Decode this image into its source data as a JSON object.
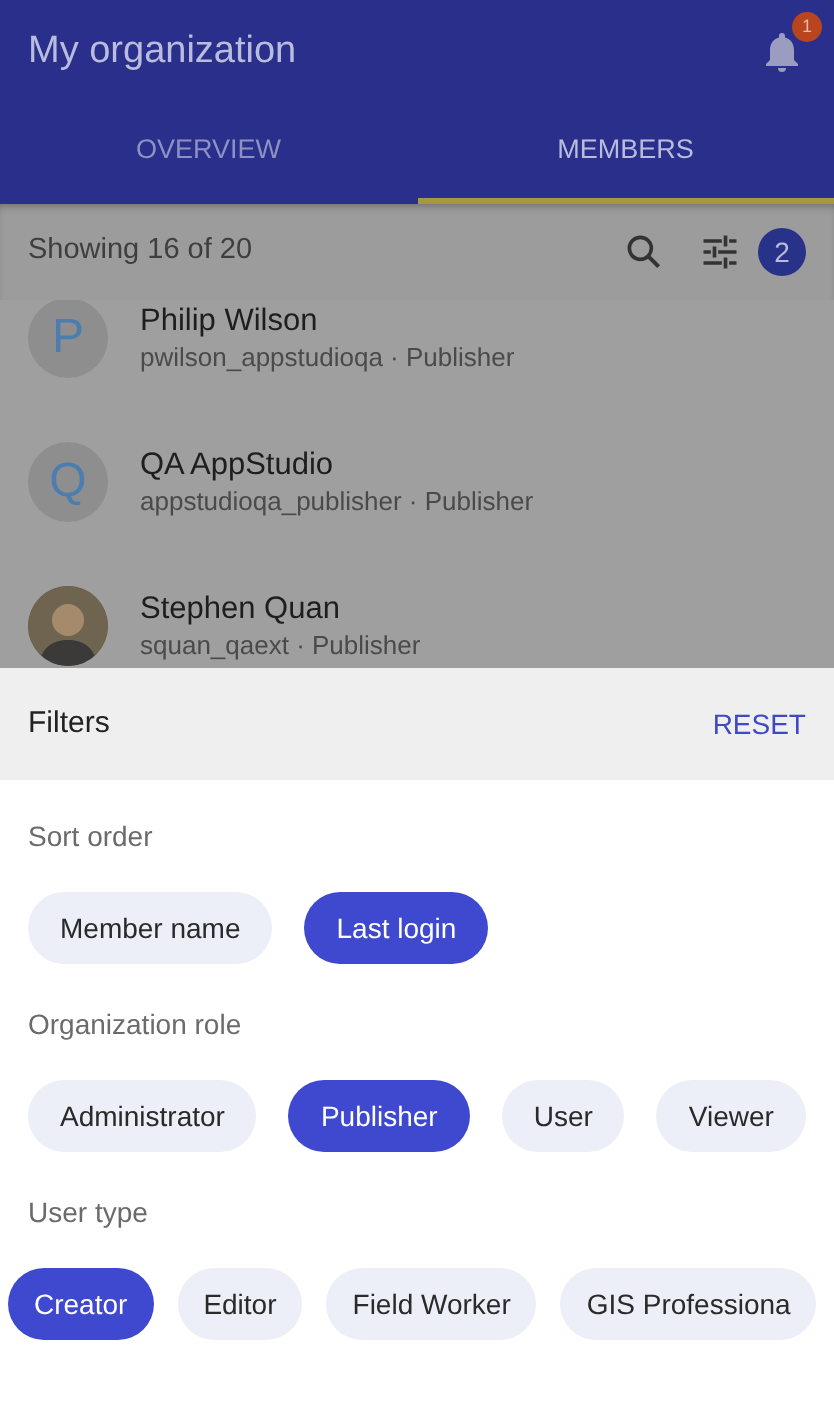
{
  "app_bar": {
    "title": "My organization",
    "notification_count": "1"
  },
  "tabs": [
    {
      "label": "OVERVIEW",
      "selected": false
    },
    {
      "label": "MEMBERS",
      "selected": true
    }
  ],
  "toolbar": {
    "summary": "Showing 16 of 20",
    "filter_count": "2"
  },
  "members": [
    {
      "kind": "initial",
      "initial": "P",
      "name": "Philip Wilson",
      "detail": "pwilson_appstudioqa · Publisher"
    },
    {
      "kind": "initial",
      "initial": "Q",
      "name": "QA AppStudio",
      "detail": "appstudioqa_publisher · Publisher"
    },
    {
      "kind": "photo",
      "name": "Stephen Quan",
      "detail": "squan_qaext · Publisher"
    }
  ],
  "filters": {
    "title": "Filters",
    "reset": "RESET",
    "groups": [
      {
        "label": "Sort order",
        "options": [
          {
            "label": "Member name",
            "selected": false
          },
          {
            "label": "Last login",
            "selected": true
          }
        ]
      },
      {
        "label": "Organization role",
        "options": [
          {
            "label": "Administrator",
            "selected": false
          },
          {
            "label": "Publisher",
            "selected": true
          },
          {
            "label": "User",
            "selected": false
          },
          {
            "label": "Viewer",
            "selected": false
          }
        ]
      },
      {
        "label": "User type",
        "options": [
          {
            "label": "Creator",
            "selected": true
          },
          {
            "label": "Editor",
            "selected": false
          },
          {
            "label": "Field Worker",
            "selected": false
          },
          {
            "label": "GIS Professiona",
            "selected": false
          }
        ]
      }
    ]
  }
}
